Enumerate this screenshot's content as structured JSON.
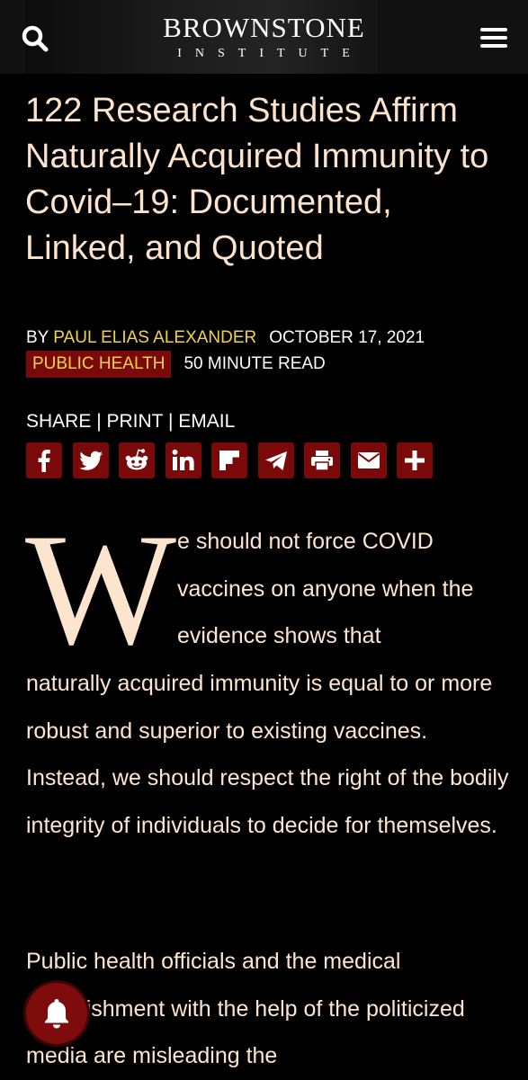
{
  "header": {
    "logo_main": "BROWNSTONE",
    "logo_sub": "INSTITUTE",
    "search_icon": "search-icon",
    "menu_icon": "hamburger-menu-icon"
  },
  "article": {
    "title": "122 Research Studies Affirm Naturally Acquired Immunity to Covid–19: Documented, Linked, and Quoted",
    "by_label": "BY ",
    "author": "PAUL ELIAS ALEXANDER",
    "date": "OCTOBER 17, 2021",
    "category": "PUBLIC HEALTH",
    "read_time": "50 MINUTE READ"
  },
  "share": {
    "share_label": "SHARE",
    "separator": " | ",
    "print_label": "PRINT",
    "email_label": "EMAIL",
    "buttons": [
      {
        "icon": "facebook-icon"
      },
      {
        "icon": "twitter-icon"
      },
      {
        "icon": "reddit-icon"
      },
      {
        "icon": "linkedin-icon"
      },
      {
        "icon": "flipboard-icon"
      },
      {
        "icon": "telegram-icon"
      },
      {
        "icon": "print-icon"
      },
      {
        "icon": "email-icon"
      },
      {
        "icon": "plus-icon"
      }
    ],
    "accent_color": "#7a0a0a"
  },
  "body": {
    "dropcap": "W",
    "para1_first": "e should not force COVID vaccines on anyone when the evidence shows that",
    "para1_rest": "naturally acquired immunity is equal to or more robust and superior to existing vaccines. Instead, we should respect the right of the bodily integrity of individuals to decide for themselves.",
    "para2": "Public health officials and the medical establishment with the help of the politicized media are misleading the"
  },
  "notification": {
    "icon": "bell-icon"
  }
}
